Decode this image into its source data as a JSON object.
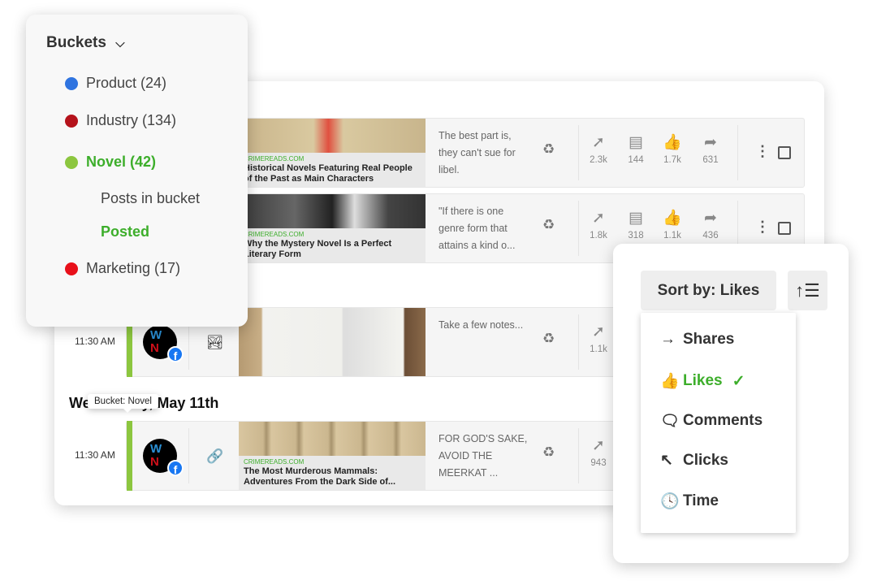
{
  "buckets": {
    "title": "Buckets",
    "items": [
      {
        "label": "Product (24)",
        "color": "#2f74e0"
      },
      {
        "label": "Industry (134)",
        "color": "#b5121b"
      },
      {
        "label": "Novel (42)",
        "color": "#8cc63f"
      },
      {
        "label": "Marketing (17)",
        "color": "#e8101a"
      }
    ],
    "sub_items": [
      "Posts in bucket",
      "Posted"
    ]
  },
  "posts": [
    {
      "time": "",
      "source": "CRIMEREADS.COM",
      "title": "Historical Novels Featuring Real People of the Past as Main Characters",
      "text": "The best part is, they can't sue for libel.",
      "clicks": "2.3k",
      "comments": "144",
      "likes": "1.7k",
      "shares": "631"
    },
    {
      "time": "",
      "source": "CRIMEREADS.COM",
      "title": "Why the Mystery Novel Is a Perfect Literary Form",
      "text": "\"If there is one genre form that attains a kind o...",
      "clicks": "1.8k",
      "comments": "318",
      "likes": "1.1k",
      "shares": "436"
    },
    {
      "time": "11:30 AM",
      "text": "Take a few notes...",
      "clicks": "1.1k"
    },
    {
      "time": "11:30 AM",
      "source": "CRIMEREADS.COM",
      "title": "The Most Murderous Mammals: Adventures From the Dark Side of...",
      "text": "FOR GOD'S SAKE, AVOID THE MEERKAT ...",
      "clicks": "943"
    }
  ],
  "day_heading": "Wednesday, May 11th",
  "tooltip": "Bucket: Novel",
  "sort": {
    "button": "Sort by: Likes",
    "options": [
      "Shares",
      "Likes",
      "Comments",
      "Clicks",
      "Time"
    ],
    "selected": "Likes"
  }
}
